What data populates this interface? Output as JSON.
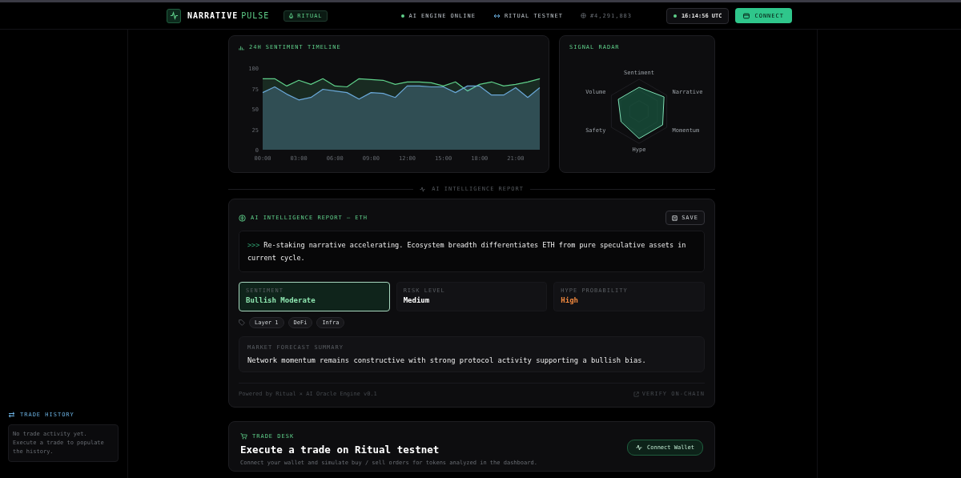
{
  "header": {
    "logo_title": "NARRATIVE",
    "logo_accent": "PULSE",
    "network_badge": "RITUAL",
    "status": [
      {
        "kind": "dot",
        "label": "AI ENGINE ONLINE"
      },
      {
        "kind": "link",
        "label": "RITUAL TESTNET"
      },
      {
        "kind": "block",
        "label": "#4,291,883"
      }
    ],
    "clock": "16:14:56 UTC",
    "connect_button": "CONNECT"
  },
  "sidebar": {
    "trade_history": {
      "title": "TRADE HISTORY",
      "empty_message": "No trade activity yet.",
      "empty_hint": "Execute a trade to populate the history."
    }
  },
  "timeline": {
    "title": "24H SENTIMENT TIMELINE",
    "chart_data": {
      "type": "area",
      "x": [
        0,
        1,
        2,
        3,
        4,
        5,
        6,
        7,
        8,
        9,
        10,
        11,
        12,
        13,
        14,
        15,
        16,
        17,
        18,
        19,
        20,
        21,
        22,
        23
      ],
      "xticks": [
        {
          "value": 0,
          "label": "00:00"
        },
        {
          "value": 3,
          "label": "03:00"
        },
        {
          "value": 6,
          "label": "06:00"
        },
        {
          "value": 9,
          "label": "09:00"
        },
        {
          "value": 12,
          "label": "12:00"
        },
        {
          "value": 15,
          "label": "15:00"
        },
        {
          "value": 18,
          "label": "18:00"
        },
        {
          "value": 21,
          "label": "21:00"
        }
      ],
      "yticks": [
        0,
        25,
        50,
        75,
        100
      ],
      "xlim": [
        0,
        23
      ],
      "ylim": [
        0,
        100
      ],
      "stacked": false,
      "series": [
        {
          "color": "#5fd08a",
          "values": [
            87,
            87,
            78,
            85,
            80,
            87,
            78,
            77,
            87,
            86,
            85,
            80,
            83,
            83,
            82,
            78,
            83,
            72,
            80,
            83,
            78,
            80,
            83,
            87
          ]
        },
        {
          "color": "#6aa8d8",
          "values": [
            70,
            77,
            68,
            61,
            64,
            74,
            72,
            70,
            62,
            70,
            69,
            64,
            78,
            78,
            77,
            77,
            70,
            78,
            78,
            67,
            67,
            76,
            64,
            76
          ]
        }
      ]
    }
  },
  "radar": {
    "title": "SIGNAL RADAR",
    "axes": [
      "Sentiment",
      "Narrative",
      "Momentum",
      "Hype",
      "Safety",
      "Volume"
    ]
  },
  "divider": "AI INTELLIGENCE REPORT",
  "report": {
    "title": "AI INTELLIGENCE REPORT — ETH",
    "save_button": "SAVE",
    "prompt": ">>>",
    "summary": "Re-staking narrative accelerating. Ecosystem breadth differentiates ETH from pure speculative assets in current cycle.",
    "metrics": [
      {
        "label": "SENTIMENT",
        "value": "Bullish Moderate",
        "selected": true,
        "color": "#8ee6b0"
      },
      {
        "label": "RISK LEVEL",
        "value": "Medium",
        "selected": false,
        "color": "#ffffff"
      },
      {
        "label": "HYPE PROBABILITY",
        "value": "High",
        "selected": false,
        "color": "#f0883e"
      }
    ],
    "tags": [
      "Layer 1",
      "DeFi",
      "Infra"
    ],
    "forecast": {
      "label": "MARKET FORECAST SUMMARY",
      "text": "Network momentum remains constructive with strong protocol activity supporting a bullish bias."
    },
    "footer": "Powered by Ritual × AI Oracle Engine v0.1",
    "verify_link": "VERIFY ON-CHAIN"
  },
  "trade_desk": {
    "label": "TRADE DESK",
    "title": "Execute a trade on Ritual testnet",
    "subtitle": "Connect your wallet and simulate buy / sell orders for tokens analyzed in the dashboard.",
    "connect_button": "Connect Wallet"
  }
}
